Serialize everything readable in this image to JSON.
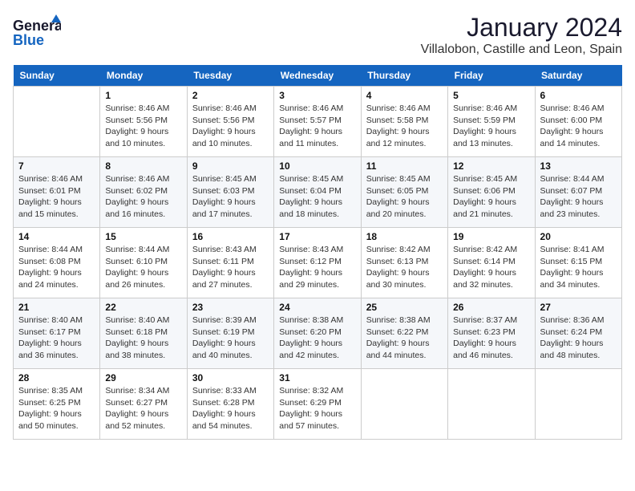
{
  "header": {
    "logo_line1": "General",
    "logo_line2": "Blue",
    "month_year": "January 2024",
    "location": "Villalobon, Castille and Leon, Spain"
  },
  "days_of_week": [
    "Sunday",
    "Monday",
    "Tuesday",
    "Wednesday",
    "Thursday",
    "Friday",
    "Saturday"
  ],
  "weeks": [
    [
      {
        "day": "",
        "sunrise": "",
        "sunset": "",
        "daylight": ""
      },
      {
        "day": "1",
        "sunrise": "Sunrise: 8:46 AM",
        "sunset": "Sunset: 5:56 PM",
        "daylight": "Daylight: 9 hours and 10 minutes."
      },
      {
        "day": "2",
        "sunrise": "Sunrise: 8:46 AM",
        "sunset": "Sunset: 5:56 PM",
        "daylight": "Daylight: 9 hours and 10 minutes."
      },
      {
        "day": "3",
        "sunrise": "Sunrise: 8:46 AM",
        "sunset": "Sunset: 5:57 PM",
        "daylight": "Daylight: 9 hours and 11 minutes."
      },
      {
        "day": "4",
        "sunrise": "Sunrise: 8:46 AM",
        "sunset": "Sunset: 5:58 PM",
        "daylight": "Daylight: 9 hours and 12 minutes."
      },
      {
        "day": "5",
        "sunrise": "Sunrise: 8:46 AM",
        "sunset": "Sunset: 5:59 PM",
        "daylight": "Daylight: 9 hours and 13 minutes."
      },
      {
        "day": "6",
        "sunrise": "Sunrise: 8:46 AM",
        "sunset": "Sunset: 6:00 PM",
        "daylight": "Daylight: 9 hours and 14 minutes."
      }
    ],
    [
      {
        "day": "7",
        "sunrise": "Sunrise: 8:46 AM",
        "sunset": "Sunset: 6:01 PM",
        "daylight": "Daylight: 9 hours and 15 minutes."
      },
      {
        "day": "8",
        "sunrise": "Sunrise: 8:46 AM",
        "sunset": "Sunset: 6:02 PM",
        "daylight": "Daylight: 9 hours and 16 minutes."
      },
      {
        "day": "9",
        "sunrise": "Sunrise: 8:45 AM",
        "sunset": "Sunset: 6:03 PM",
        "daylight": "Daylight: 9 hours and 17 minutes."
      },
      {
        "day": "10",
        "sunrise": "Sunrise: 8:45 AM",
        "sunset": "Sunset: 6:04 PM",
        "daylight": "Daylight: 9 hours and 18 minutes."
      },
      {
        "day": "11",
        "sunrise": "Sunrise: 8:45 AM",
        "sunset": "Sunset: 6:05 PM",
        "daylight": "Daylight: 9 hours and 20 minutes."
      },
      {
        "day": "12",
        "sunrise": "Sunrise: 8:45 AM",
        "sunset": "Sunset: 6:06 PM",
        "daylight": "Daylight: 9 hours and 21 minutes."
      },
      {
        "day": "13",
        "sunrise": "Sunrise: 8:44 AM",
        "sunset": "Sunset: 6:07 PM",
        "daylight": "Daylight: 9 hours and 23 minutes."
      }
    ],
    [
      {
        "day": "14",
        "sunrise": "Sunrise: 8:44 AM",
        "sunset": "Sunset: 6:08 PM",
        "daylight": "Daylight: 9 hours and 24 minutes."
      },
      {
        "day": "15",
        "sunrise": "Sunrise: 8:44 AM",
        "sunset": "Sunset: 6:10 PM",
        "daylight": "Daylight: 9 hours and 26 minutes."
      },
      {
        "day": "16",
        "sunrise": "Sunrise: 8:43 AM",
        "sunset": "Sunset: 6:11 PM",
        "daylight": "Daylight: 9 hours and 27 minutes."
      },
      {
        "day": "17",
        "sunrise": "Sunrise: 8:43 AM",
        "sunset": "Sunset: 6:12 PM",
        "daylight": "Daylight: 9 hours and 29 minutes."
      },
      {
        "day": "18",
        "sunrise": "Sunrise: 8:42 AM",
        "sunset": "Sunset: 6:13 PM",
        "daylight": "Daylight: 9 hours and 30 minutes."
      },
      {
        "day": "19",
        "sunrise": "Sunrise: 8:42 AM",
        "sunset": "Sunset: 6:14 PM",
        "daylight": "Daylight: 9 hours and 32 minutes."
      },
      {
        "day": "20",
        "sunrise": "Sunrise: 8:41 AM",
        "sunset": "Sunset: 6:15 PM",
        "daylight": "Daylight: 9 hours and 34 minutes."
      }
    ],
    [
      {
        "day": "21",
        "sunrise": "Sunrise: 8:40 AM",
        "sunset": "Sunset: 6:17 PM",
        "daylight": "Daylight: 9 hours and 36 minutes."
      },
      {
        "day": "22",
        "sunrise": "Sunrise: 8:40 AM",
        "sunset": "Sunset: 6:18 PM",
        "daylight": "Daylight: 9 hours and 38 minutes."
      },
      {
        "day": "23",
        "sunrise": "Sunrise: 8:39 AM",
        "sunset": "Sunset: 6:19 PM",
        "daylight": "Daylight: 9 hours and 40 minutes."
      },
      {
        "day": "24",
        "sunrise": "Sunrise: 8:38 AM",
        "sunset": "Sunset: 6:20 PM",
        "daylight": "Daylight: 9 hours and 42 minutes."
      },
      {
        "day": "25",
        "sunrise": "Sunrise: 8:38 AM",
        "sunset": "Sunset: 6:22 PM",
        "daylight": "Daylight: 9 hours and 44 minutes."
      },
      {
        "day": "26",
        "sunrise": "Sunrise: 8:37 AM",
        "sunset": "Sunset: 6:23 PM",
        "daylight": "Daylight: 9 hours and 46 minutes."
      },
      {
        "day": "27",
        "sunrise": "Sunrise: 8:36 AM",
        "sunset": "Sunset: 6:24 PM",
        "daylight": "Daylight: 9 hours and 48 minutes."
      }
    ],
    [
      {
        "day": "28",
        "sunrise": "Sunrise: 8:35 AM",
        "sunset": "Sunset: 6:25 PM",
        "daylight": "Daylight: 9 hours and 50 minutes."
      },
      {
        "day": "29",
        "sunrise": "Sunrise: 8:34 AM",
        "sunset": "Sunset: 6:27 PM",
        "daylight": "Daylight: 9 hours and 52 minutes."
      },
      {
        "day": "30",
        "sunrise": "Sunrise: 8:33 AM",
        "sunset": "Sunset: 6:28 PM",
        "daylight": "Daylight: 9 hours and 54 minutes."
      },
      {
        "day": "31",
        "sunrise": "Sunrise: 8:32 AM",
        "sunset": "Sunset: 6:29 PM",
        "daylight": "Daylight: 9 hours and 57 minutes."
      },
      {
        "day": "",
        "sunrise": "",
        "sunset": "",
        "daylight": ""
      },
      {
        "day": "",
        "sunrise": "",
        "sunset": "",
        "daylight": ""
      },
      {
        "day": "",
        "sunrise": "",
        "sunset": "",
        "daylight": ""
      }
    ]
  ]
}
